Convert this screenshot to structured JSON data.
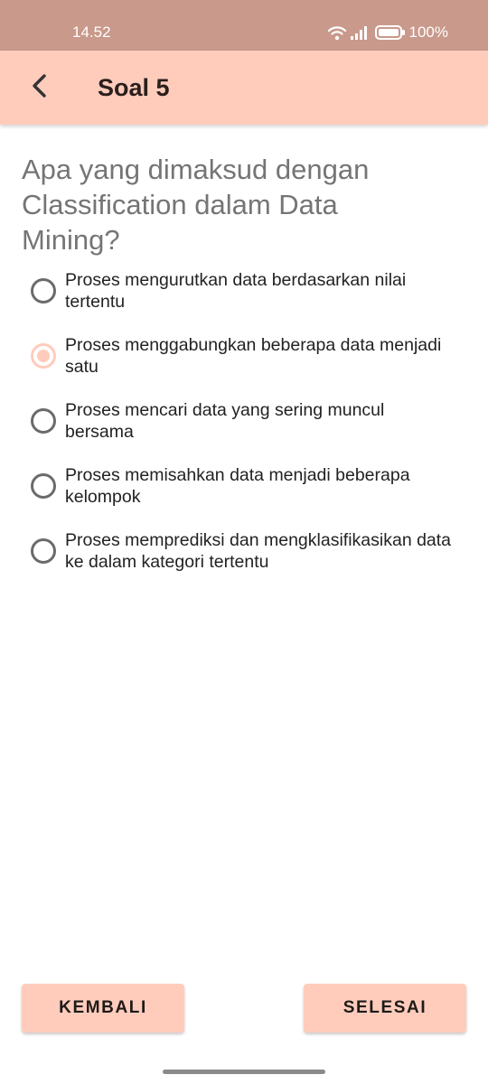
{
  "status_bar": {
    "time": "14.52",
    "battery": "100%",
    "icons": [
      "wifi-icon",
      "signal-icon",
      "battery-icon"
    ]
  },
  "app_bar": {
    "back_icon": "chevron-left-icon",
    "title": "Soal 5"
  },
  "question": {
    "text": "Apa yang dimaksud dengan Classification dalam Data Mining?"
  },
  "options": [
    {
      "label": "Proses mengurutkan data berdasarkan nilai tertentu",
      "selected": false
    },
    {
      "label": "Proses menggabungkan beberapa data menjadi satu",
      "selected": true
    },
    {
      "label": "Proses mencari data yang sering muncul bersama",
      "selected": false
    },
    {
      "label": "Proses memisahkan data menjadi beberapa kelompok",
      "selected": false
    },
    {
      "label": "Proses memprediksi dan mengklasifikasikan data ke dalam kategori tertentu",
      "selected": false
    }
  ],
  "buttons": {
    "back_label": "KEMBALI",
    "finish_label": "SELESAI"
  },
  "colors": {
    "status_bar": "#c9998b",
    "accent": "#ffccbc",
    "question_text": "#757575"
  }
}
